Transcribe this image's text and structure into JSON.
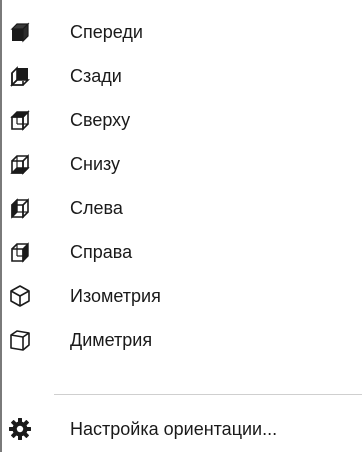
{
  "menu": {
    "items": [
      {
        "label": "Спереди",
        "icon": "view-front-icon"
      },
      {
        "label": "Сзади",
        "icon": "view-back-icon"
      },
      {
        "label": "Сверху",
        "icon": "view-top-icon"
      },
      {
        "label": "Снизу",
        "icon": "view-bottom-icon"
      },
      {
        "label": "Слева",
        "icon": "view-left-icon"
      },
      {
        "label": "Справа",
        "icon": "view-right-icon"
      },
      {
        "label": "Изометрия",
        "icon": "view-isometric-icon"
      },
      {
        "label": "Диметрия",
        "icon": "view-dimetric-icon"
      }
    ],
    "settings": {
      "label": "Настройка ориентации...",
      "icon": "gear-icon"
    }
  }
}
